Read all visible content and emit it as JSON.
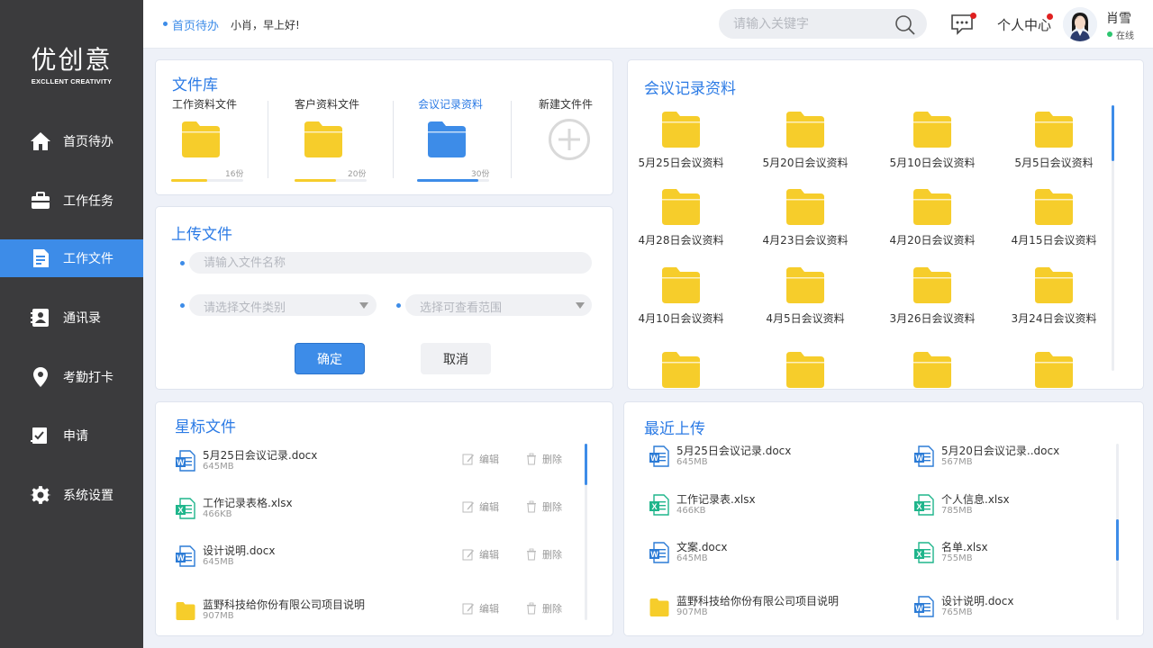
{
  "app": {
    "logo": "优创意",
    "logo_sub": "EXCLLENT CREATIVITY"
  },
  "sidebar": {
    "items": [
      {
        "label": "首页待办",
        "icon": "home-icon"
      },
      {
        "label": "工作任务",
        "icon": "briefcase-icon"
      },
      {
        "label": "工作文件",
        "icon": "document-icon",
        "active": true
      },
      {
        "label": "通讯录",
        "icon": "contacts-icon"
      },
      {
        "label": "考勤打卡",
        "icon": "location-icon"
      },
      {
        "label": "申请",
        "icon": "apply-icon"
      },
      {
        "label": "系统设置",
        "icon": "gear-icon"
      }
    ]
  },
  "header": {
    "breadcrumb": "首页待办",
    "greeting": "小肖，早上好!",
    "search_placeholder": "请输入关键字",
    "personal_center": "个人中心",
    "username": "肖雪",
    "status": "在线"
  },
  "library": {
    "title": "文件库",
    "folders": [
      {
        "label": "工作资料文件",
        "count": "16份",
        "progress": 0.5,
        "color": "#f6cd2b"
      },
      {
        "label": "客户资料文件",
        "count": "20份",
        "progress": 0.58,
        "color": "#f6cd2b"
      },
      {
        "label": "会议记录资料",
        "count": "30份",
        "progress": 0.85,
        "color": "#3d8ce8",
        "active": true
      }
    ],
    "new_label": "新建文件件"
  },
  "upload": {
    "title": "上传文件",
    "name_placeholder": "请输入文件名称",
    "category_placeholder": "请选择文件类别",
    "scope_placeholder": "选择可查看范围",
    "confirm": "确定",
    "cancel": "取消"
  },
  "meeting": {
    "title": "会议记录资料",
    "folders": [
      "5月25日会议资料",
      "5月20日会议资料",
      "5月10日会议资料",
      "5月5日会议资料",
      "4月28日会议资料",
      "4月23日会议资料",
      "4月20日会议资料",
      "4月15日会议资料",
      "4月10日会议资料",
      "4月5日会议资料",
      "3月26日会议资料",
      "3月24日会议资料"
    ]
  },
  "starred": {
    "title": "星标文件",
    "edit": "编辑",
    "delete": "删除",
    "files": [
      {
        "name": "5月25日会议记录.docx",
        "size": "645MB",
        "type": "word"
      },
      {
        "name": "工作记录表格.xlsx",
        "size": "466KB",
        "type": "excel"
      },
      {
        "name": "设计说明.docx",
        "size": "645MB",
        "type": "word"
      },
      {
        "name": "蓝野科技给你份有限公司项目说明",
        "size": "907MB",
        "type": "folder"
      }
    ]
  },
  "recent": {
    "title": "最近上传",
    "files": [
      {
        "name": "5月25日会议记录.docx",
        "size": "645MB",
        "type": "word"
      },
      {
        "name": "5月20日会议记录..docx",
        "size": "567MB",
        "type": "word"
      },
      {
        "name": "工作记录表.xlsx",
        "size": "466KB",
        "type": "excel"
      },
      {
        "name": "个人信息.xlsx",
        "size": "785MB",
        "type": "excel"
      },
      {
        "name": "文案.docx",
        "size": "645MB",
        "type": "word"
      },
      {
        "name": "名单.xlsx",
        "size": "755MB",
        "type": "excel"
      },
      {
        "name": "蓝野科技给你份有限公司项目说明",
        "size": "907MB",
        "type": "folder"
      },
      {
        "name": "设计说明.docx",
        "size": "765MB",
        "type": "word"
      }
    ]
  },
  "colors": {
    "accent": "#3d8ce8",
    "sidebar": "#3b3b3d",
    "folder": "#f6cd2b",
    "excel": "#1fb58b"
  }
}
